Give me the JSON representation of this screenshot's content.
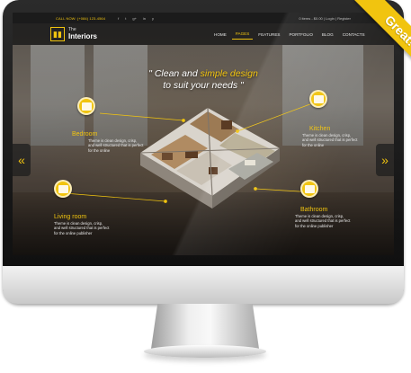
{
  "topbar": {
    "call": "CALL NOW: (+084) 123-4564",
    "social": [
      "f",
      "t",
      "g+",
      "in",
      "y"
    ],
    "cart": "0 items - $0.00 | Login | Register"
  },
  "brand": {
    "logo_glyph": "▮▮",
    "the": "The",
    "name": "Interiors"
  },
  "nav": {
    "items": [
      "HOME",
      "PAGES",
      "FEATURES",
      "PORTFOLIO",
      "BLOG",
      "CONTACTS"
    ],
    "active_index": 1
  },
  "hero": {
    "quote_open": "\" Clean and ",
    "quote_highlight": "simple design",
    "quote_line2": "to suit your needs \""
  },
  "callouts": {
    "bedroom": {
      "title": "Bedroom",
      "desc": "Theme is clean design, crisp, and well structured that is perfect for the online"
    },
    "kitchen": {
      "title": "Kitchen",
      "desc": "Theme is clean design, crisp, and well structured that is perfect for the online"
    },
    "living": {
      "title": "Living room",
      "desc": "Theme is clean design, crisp, and well structured that is perfect for the online publisher"
    },
    "bathroom": {
      "title": "Bathroom",
      "desc": "Theme is clean design, crisp, and well structured that is perfect for the online publisher"
    }
  },
  "arrows": {
    "prev": "«",
    "next": "»"
  },
  "ribbon": {
    "label": "Great!"
  },
  "colors": {
    "accent": "#f1c40f",
    "dark": "#1b1b1b"
  }
}
